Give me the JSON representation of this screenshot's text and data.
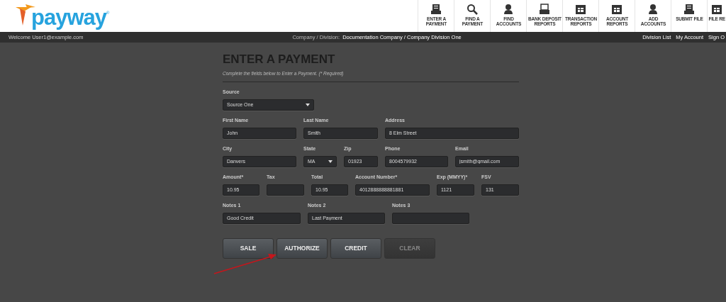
{
  "logo": {
    "text": "payway",
    "mark": "®"
  },
  "nav": [
    {
      "kind": "printer",
      "label": "ENTER A PAYMENT"
    },
    {
      "kind": "search",
      "label": "FIND A PAYMENT"
    },
    {
      "kind": "person",
      "label": "FIND ACCOUNTS"
    },
    {
      "kind": "tray",
      "label": "BANK DEPOSIT REPORTS"
    },
    {
      "kind": "calendar",
      "label": "TRANSACTION REPORTS"
    },
    {
      "kind": "calendar",
      "label": "ACCOUNT REPORTS"
    },
    {
      "kind": "person",
      "label": "ADD ACCOUNTS"
    },
    {
      "kind": "printer",
      "label": "SUBMIT FILE"
    },
    {
      "kind": "calendar",
      "label": "FILE RE"
    }
  ],
  "status_bar": {
    "welcome": "Welcome User1@example.com",
    "company_label": "Company / Division:",
    "company": "Documentation Company / Company Division One",
    "links": [
      "Division List",
      "My Account",
      "Sign O"
    ]
  },
  "form": {
    "title": "ENTER A PAYMENT",
    "subtitle": "Complete the fields below to Enter a Payment. (* Required)",
    "field_lines": [
      {
        "fields": [
          {
            "kind": "select",
            "label": "Source",
            "value": "Source One"
          }
        ]
      },
      {
        "fields": [
          {
            "kind": "text",
            "label": "First Name",
            "value": "John"
          },
          {
            "kind": "text",
            "label": "Last Name",
            "value": "Smith"
          },
          {
            "kind": "text",
            "label": "Address",
            "value": "8 Elm Street"
          }
        ]
      },
      {
        "fields": [
          {
            "kind": "text",
            "label": "City",
            "value": "Danvers"
          },
          {
            "kind": "select",
            "label": "State",
            "value": "MA"
          },
          {
            "kind": "text",
            "label": "Zip",
            "value": "01923"
          },
          {
            "kind": "text",
            "label": "Phone",
            "value": "8004579932"
          },
          {
            "kind": "text",
            "label": "Email",
            "value": "jsmith@gmail.com"
          }
        ]
      },
      {
        "fields": [
          {
            "kind": "text",
            "label": "Amount*",
            "value": "10.95"
          },
          {
            "kind": "text",
            "label": "Tax"
          },
          {
            "kind": "text",
            "label": "Total",
            "value": "10.95"
          },
          {
            "kind": "text",
            "label": "Account Number*",
            "value": "4012888888881881"
          },
          {
            "kind": "text",
            "label": "Exp (MMYY)*",
            "value": "1121"
          },
          {
            "kind": "text",
            "label": "FSV",
            "value": "131"
          }
        ]
      },
      {
        "fields": [
          {
            "kind": "text",
            "label": "Notes 1",
            "value": "Good Credit"
          },
          {
            "kind": "text",
            "label": "Notes 2",
            "value": "Last Payment"
          },
          {
            "kind": "text",
            "label": "Notes 3"
          }
        ]
      }
    ],
    "buttons": [
      {
        "label": "SALE",
        "disabled": false
      },
      {
        "label": "AUTHORIZE",
        "disabled": false
      },
      {
        "label": "CREDIT",
        "disabled": false
      },
      {
        "label": "CLEAR",
        "disabled": true
      }
    ]
  }
}
